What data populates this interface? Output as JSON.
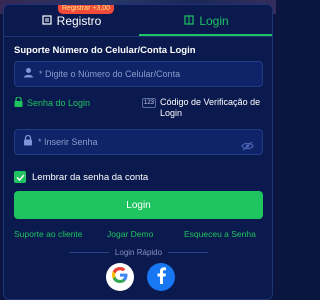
{
  "tabs": {
    "register_label": "Registro",
    "login_label": "Login",
    "promo_badge": "Registrar +3,00"
  },
  "form": {
    "section_label": "Suporte Número do Celular/Conta Login",
    "phone_placeholder": "* Digite o Número do Celular/Conta",
    "method_password": "Senha do Login",
    "method_code": "Código de Verificação de Login",
    "password_placeholder": "* Inserir Senha",
    "remember_label": "Lembrar da senha da conta",
    "remember_checked": true,
    "login_button": "Login"
  },
  "links": {
    "support": "Suporte ao cliente",
    "demo": "Jogar Demo",
    "forgot": "Esqueceu a Senha"
  },
  "quick_login": {
    "label": "Login Rápido",
    "providers": [
      "Google",
      "Facebook"
    ]
  },
  "colors": {
    "accent": "#1fc35f",
    "background": "#0b1a4e",
    "field": "#0f2468",
    "badge": "#f24a3a"
  }
}
